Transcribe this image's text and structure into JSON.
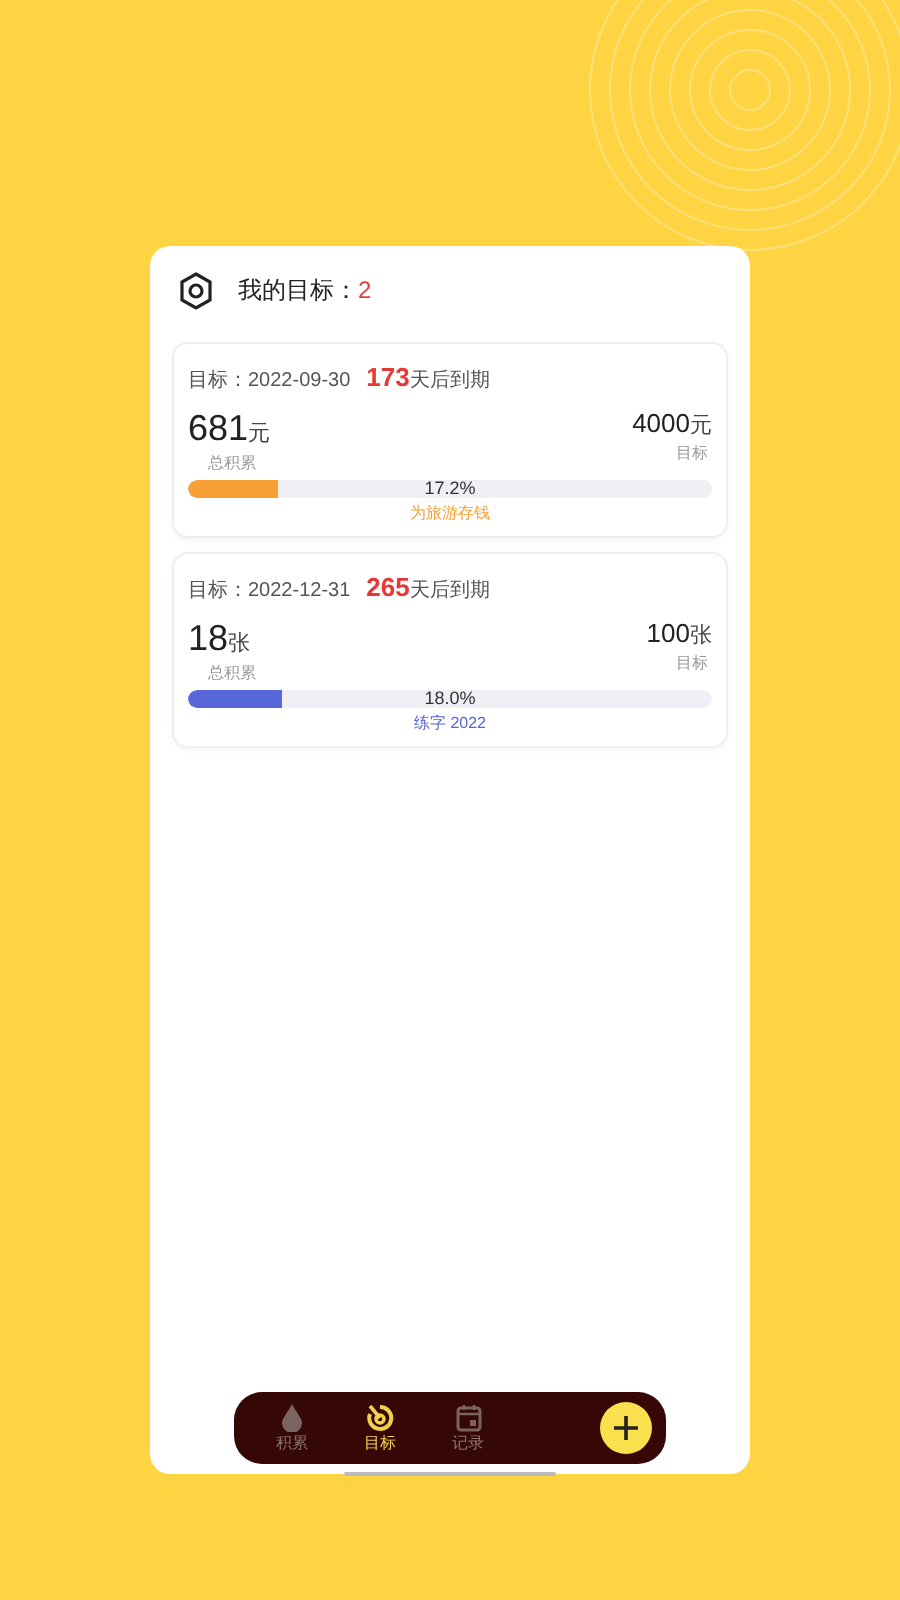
{
  "header": {
    "title": "我的目标：",
    "count": "2"
  },
  "goals": [
    {
      "date_label": "目标：2022-09-30",
      "days": "173",
      "days_suffix": "天后到期",
      "current": "681",
      "current_unit": "元",
      "current_label": "总积累",
      "target": "4000",
      "target_unit": "元",
      "target_label": "目标",
      "level": 0.172,
      "percent": "17.2%",
      "name": "为旅游存钱",
      "color": "#f7a035"
    },
    {
      "date_label": "目标：2022-12-31",
      "days": "265",
      "days_suffix": "天后到期",
      "current": "18",
      "current_unit": "张",
      "current_label": "总积累",
      "target": "100",
      "target_unit": "张",
      "target_label": "目标",
      "level": 0.18,
      "percent": "18.0%",
      "name": "练字 2022",
      "color": "#5766d8"
    }
  ],
  "tabbar": {
    "tabs": [
      {
        "kind": "drop",
        "label": "积累",
        "selected": false
      },
      {
        "kind": "target",
        "label": "目标",
        "selected": true
      },
      {
        "kind": "calendar",
        "label": "记录",
        "selected": false
      }
    ]
  }
}
